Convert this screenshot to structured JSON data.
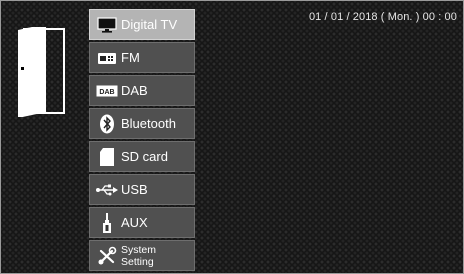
{
  "datetime": "01 / 01 / 2018 ( Mon. ) 00 : 00",
  "menu": {
    "items": [
      {
        "label": "Digital TV",
        "icon": "tv-icon",
        "selected": true
      },
      {
        "label": "FM",
        "icon": "radio-icon"
      },
      {
        "label": "DAB",
        "icon": "dab-icon",
        "badge": "DAB"
      },
      {
        "label": "Bluetooth",
        "icon": "bluetooth-icon"
      },
      {
        "label": "SD card",
        "icon": "sd-card-icon"
      },
      {
        "label": "USB",
        "icon": "usb-icon"
      },
      {
        "label": "AUX",
        "icon": "aux-jack-icon"
      },
      {
        "label": "System Setting",
        "icon": "settings-tools-icon"
      }
    ]
  }
}
